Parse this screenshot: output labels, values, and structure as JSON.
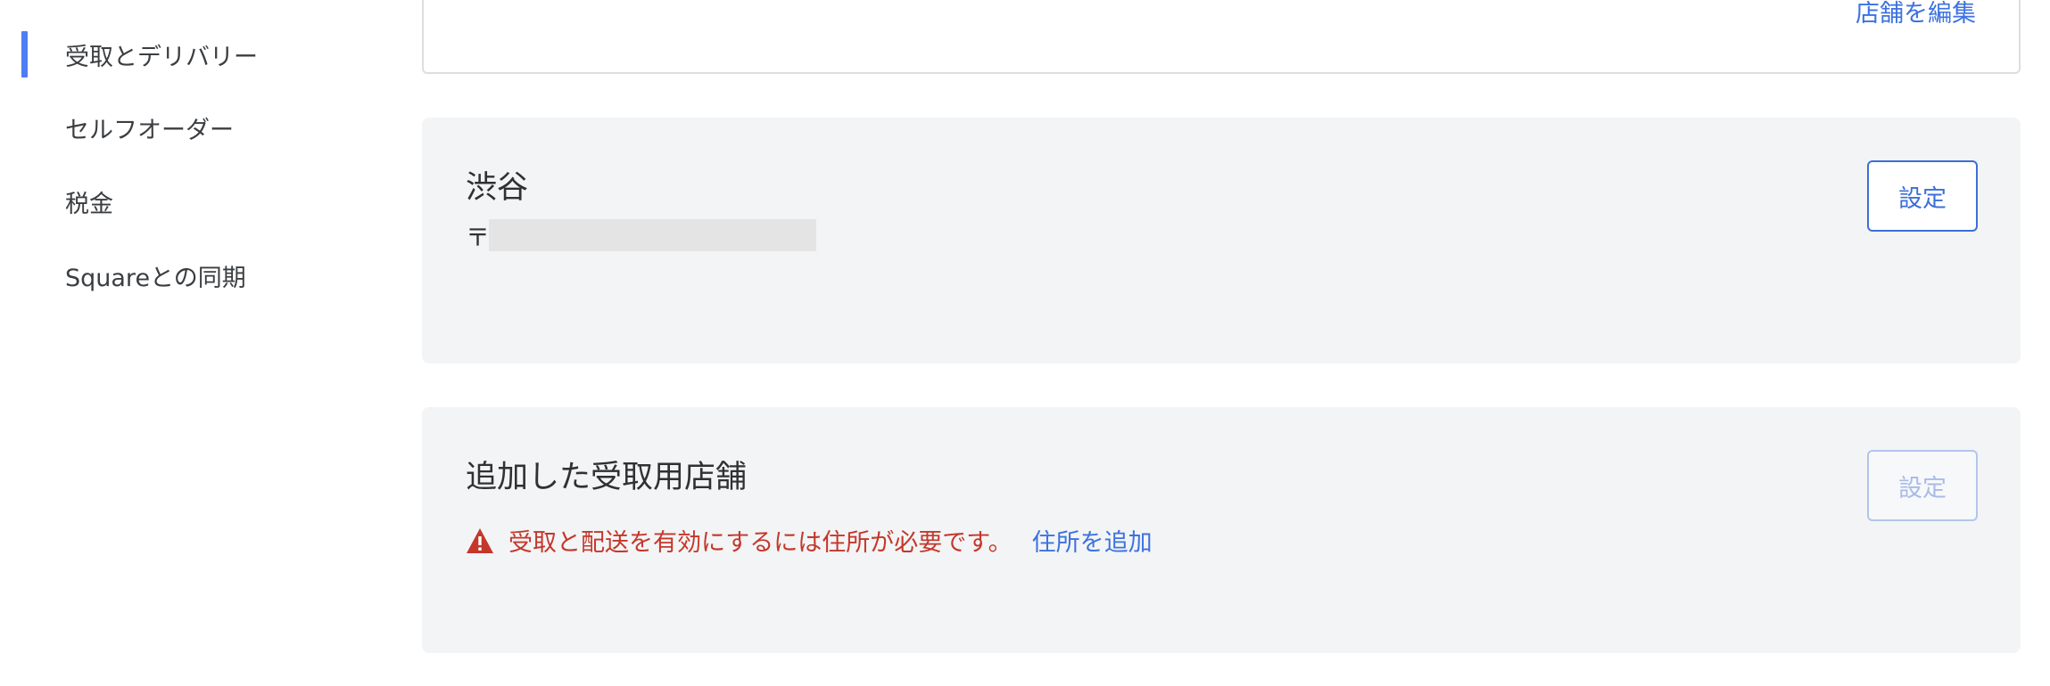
{
  "sidebar": {
    "items": [
      {
        "label": "受取とデリバリー",
        "active": true
      },
      {
        "label": "セルフオーダー",
        "active": false
      },
      {
        "label": "税金",
        "active": false
      },
      {
        "label": "Squareとの同期",
        "active": false
      }
    ]
  },
  "top_card": {
    "edit_link": "店舗を編集"
  },
  "location_card": {
    "title": "渋谷",
    "postal_mark": "〒",
    "settings_button": "設定"
  },
  "pickup_card": {
    "title": "追加した受取用店舗",
    "warning_text": "受取と配送を有効にするには住所が必要です。",
    "add_address_link": "住所を追加",
    "settings_button": "設定",
    "settings_disabled": true
  },
  "colors": {
    "accent": "#3c72e0",
    "active_indicator": "#4d7ef3",
    "warning": "#c4372b",
    "card_bg": "#f3f4f5"
  },
  "icons": {
    "warning": "warning-triangle-icon"
  }
}
